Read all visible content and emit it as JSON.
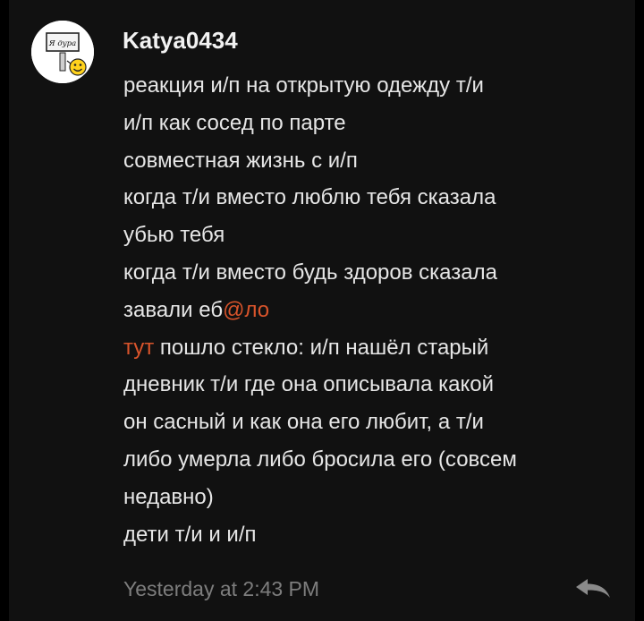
{
  "comment": {
    "username": "Katya0434",
    "avatar_sign_text": "Я дура",
    "lines": [
      {
        "text": "реакция и/п на открытую одежду т/и"
      },
      {
        "text": "и/п как сосед по парте"
      },
      {
        "text": "совместная жизнь с и/п"
      },
      {
        "text": "когда т/и вместо люблю тебя сказала"
      },
      {
        "text": "убью тебя"
      },
      {
        "text": "когда т/и вместо будь здоров сказала"
      },
      {
        "before": "завали еб",
        "mention": "@ло"
      },
      {
        "mention": "тут",
        "after": " пошло стекло: и/п нашёл старый"
      },
      {
        "text": "дневник т/и где она описывала какой"
      },
      {
        "text": "он сасный и как она его любит, а т/и"
      },
      {
        "text": "либо умерла либо бросила его (совсем"
      },
      {
        "text": "недавно)"
      },
      {
        "text": "дети т/и и и/п"
      }
    ],
    "timestamp": "Yesterday at 2:43 PM",
    "reply_icon": "reply-arrow-icon"
  },
  "colors": {
    "background": "#111111",
    "text": "#e6e6e6",
    "mention": "#d9542b",
    "timestamp": "#7d7d7d"
  }
}
